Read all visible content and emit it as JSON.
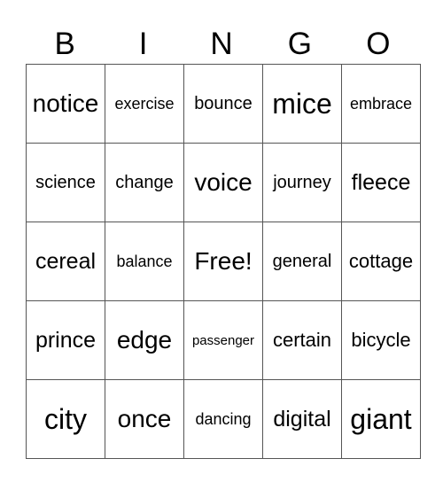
{
  "header": [
    "B",
    "I",
    "N",
    "G",
    "O"
  ],
  "rows": [
    [
      {
        "text": "notice",
        "size": "s-l"
      },
      {
        "text": "exercise",
        "size": "s-s"
      },
      {
        "text": "bounce",
        "size": "s-sm"
      },
      {
        "text": "mice",
        "size": "s-xl"
      },
      {
        "text": "embrace",
        "size": "s-s"
      }
    ],
    [
      {
        "text": "science",
        "size": "s-sm"
      },
      {
        "text": "change",
        "size": "s-sm"
      },
      {
        "text": "voice",
        "size": "s-l"
      },
      {
        "text": "journey",
        "size": "s-sm"
      },
      {
        "text": "fleece",
        "size": "s-m"
      }
    ],
    [
      {
        "text": "cereal",
        "size": "s-m"
      },
      {
        "text": "balance",
        "size": "s-s"
      },
      {
        "text": "Free!",
        "size": "s-l"
      },
      {
        "text": "general",
        "size": "s-sm"
      },
      {
        "text": "cottage",
        "size": "s-ml"
      }
    ],
    [
      {
        "text": "prince",
        "size": "s-m"
      },
      {
        "text": "edge",
        "size": "s-l"
      },
      {
        "text": "passenger",
        "size": "s-xs"
      },
      {
        "text": "certain",
        "size": "s-ml"
      },
      {
        "text": "bicycle",
        "size": "s-ml"
      }
    ],
    [
      {
        "text": "city",
        "size": "s-xl"
      },
      {
        "text": "once",
        "size": "s-l"
      },
      {
        "text": "dancing",
        "size": "s-s"
      },
      {
        "text": "digital",
        "size": "s-m"
      },
      {
        "text": "giant",
        "size": "s-xl"
      }
    ]
  ]
}
